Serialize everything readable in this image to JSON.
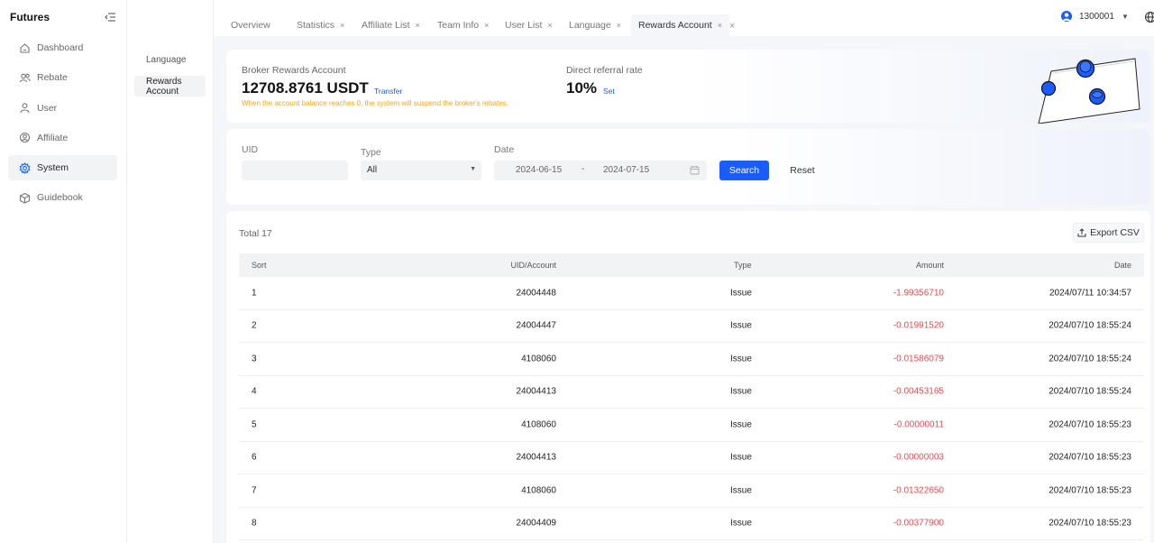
{
  "sidebar": {
    "brand": "Futures",
    "items": [
      {
        "label": "Dashboard",
        "icon": "home-icon"
      },
      {
        "label": "Rebate",
        "icon": "users-icon"
      },
      {
        "label": "User",
        "icon": "user-icon"
      },
      {
        "label": "Affiliate",
        "icon": "affiliate-icon"
      },
      {
        "label": "System",
        "icon": "gear-icon",
        "active": true
      },
      {
        "label": "Guidebook",
        "icon": "box-icon"
      }
    ]
  },
  "submenu": {
    "items": [
      {
        "label": "Language"
      },
      {
        "label": "Rewards Account",
        "active": true
      }
    ]
  },
  "tabs": [
    {
      "label": "Overview",
      "closable": false
    },
    {
      "label": "Statistics",
      "closable": true
    },
    {
      "label": "Affiliate List",
      "closable": true
    },
    {
      "label": "Team Info",
      "closable": true
    },
    {
      "label": "User List",
      "closable": true
    },
    {
      "label": "Language",
      "closable": true
    },
    {
      "label": "Rewards Account",
      "closable": true,
      "active": true
    }
  ],
  "header": {
    "username": "1300001",
    "close_icon": "×",
    "tab_close": "×",
    "caret": "▼"
  },
  "account": {
    "label": "Broker Rewards Account",
    "value": "12708.8761 USDT",
    "transfer_label": "Transfer",
    "warning": "When the account balance reaches 0, the system will suspend the broker's rebates.",
    "rate_label": "Direct referral rate",
    "rate_value": "10%",
    "set_label": "Set"
  },
  "filter": {
    "uid_label": "UID",
    "uid_value": "",
    "type_label": "Type",
    "type_value": "All",
    "date_label": "Date",
    "date_start": "2024-06-15",
    "date_sep": "-",
    "date_end": "2024-07-15",
    "search_label": "Search",
    "reset_label": "Reset"
  },
  "table": {
    "total": "Total 17",
    "export_label": "Export CSV",
    "columns": {
      "sort": "Sort",
      "uid": "UID/Account",
      "type": "Type",
      "amount": "Amount",
      "date": "Date"
    },
    "rows": [
      {
        "sort": "1",
        "uid": "24004448",
        "type": "Issue",
        "amount": "-1.99356710",
        "date": "2024/07/11 10:34:57"
      },
      {
        "sort": "2",
        "uid": "24004447",
        "type": "Issue",
        "amount": "-0.01991520",
        "date": "2024/07/10 18:55:24"
      },
      {
        "sort": "3",
        "uid": "4108060",
        "type": "Issue",
        "amount": "-0.01586079",
        "date": "2024/07/10 18:55:24"
      },
      {
        "sort": "4",
        "uid": "24004413",
        "type": "Issue",
        "amount": "-0.00453165",
        "date": "2024/07/10 18:55:24"
      },
      {
        "sort": "5",
        "uid": "4108060",
        "type": "Issue",
        "amount": "-0.00000011",
        "date": "2024/07/10 18:55:23"
      },
      {
        "sort": "6",
        "uid": "24004413",
        "type": "Issue",
        "amount": "-0.00000003",
        "date": "2024/07/10 18:55:23"
      },
      {
        "sort": "7",
        "uid": "4108060",
        "type": "Issue",
        "amount": "-0.01322650",
        "date": "2024/07/10 18:55:23"
      },
      {
        "sort": "8",
        "uid": "24004409",
        "type": "Issue",
        "amount": "-0.00377900",
        "date": "2024/07/10 18:55:23"
      }
    ]
  },
  "colors": {
    "accent": "#1a5cff",
    "negative": "#f0484e",
    "warning": "#f5a623"
  }
}
